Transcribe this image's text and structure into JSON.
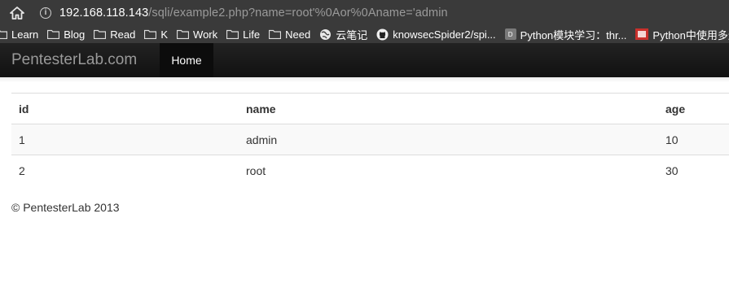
{
  "browser": {
    "url_host": "192.168.118.143",
    "url_path": "/sqli/example2.php?name=root'%0Aor%0Aname='admin",
    "bookmarks": [
      {
        "label": "Learn",
        "icon": "folder-icon"
      },
      {
        "label": "Blog",
        "icon": "folder-icon"
      },
      {
        "label": "Read",
        "icon": "folder-icon"
      },
      {
        "label": "K",
        "icon": "folder-icon"
      },
      {
        "label": "Work",
        "icon": "folder-icon"
      },
      {
        "label": "Life",
        "icon": "folder-icon"
      },
      {
        "label": "Need",
        "icon": "folder-icon"
      },
      {
        "label": "云笔记",
        "icon": "globe-icon"
      },
      {
        "label": "knowsecSpider2/spi...",
        "icon": "github-icon"
      },
      {
        "label": "Python模块学习：thr...",
        "icon": "doc-favicon-icon"
      },
      {
        "label": "Python中使用多进程",
        "icon": "red-favicon-icon"
      }
    ]
  },
  "navbar": {
    "brand": "PentesterLab.com",
    "home_label": "Home"
  },
  "table": {
    "headers": [
      "id",
      "name",
      "age"
    ],
    "rows": [
      [
        "1",
        "admin",
        "10"
      ],
      [
        "2",
        "root",
        "30"
      ]
    ]
  },
  "footer": {
    "text": "© PentesterLab 2013"
  },
  "colors": {
    "chrome_bg": "#3a3a3a",
    "navbar_bg": "#1b1b1b",
    "brand_text": "#999999",
    "striped_row": "#f9f9f9"
  }
}
